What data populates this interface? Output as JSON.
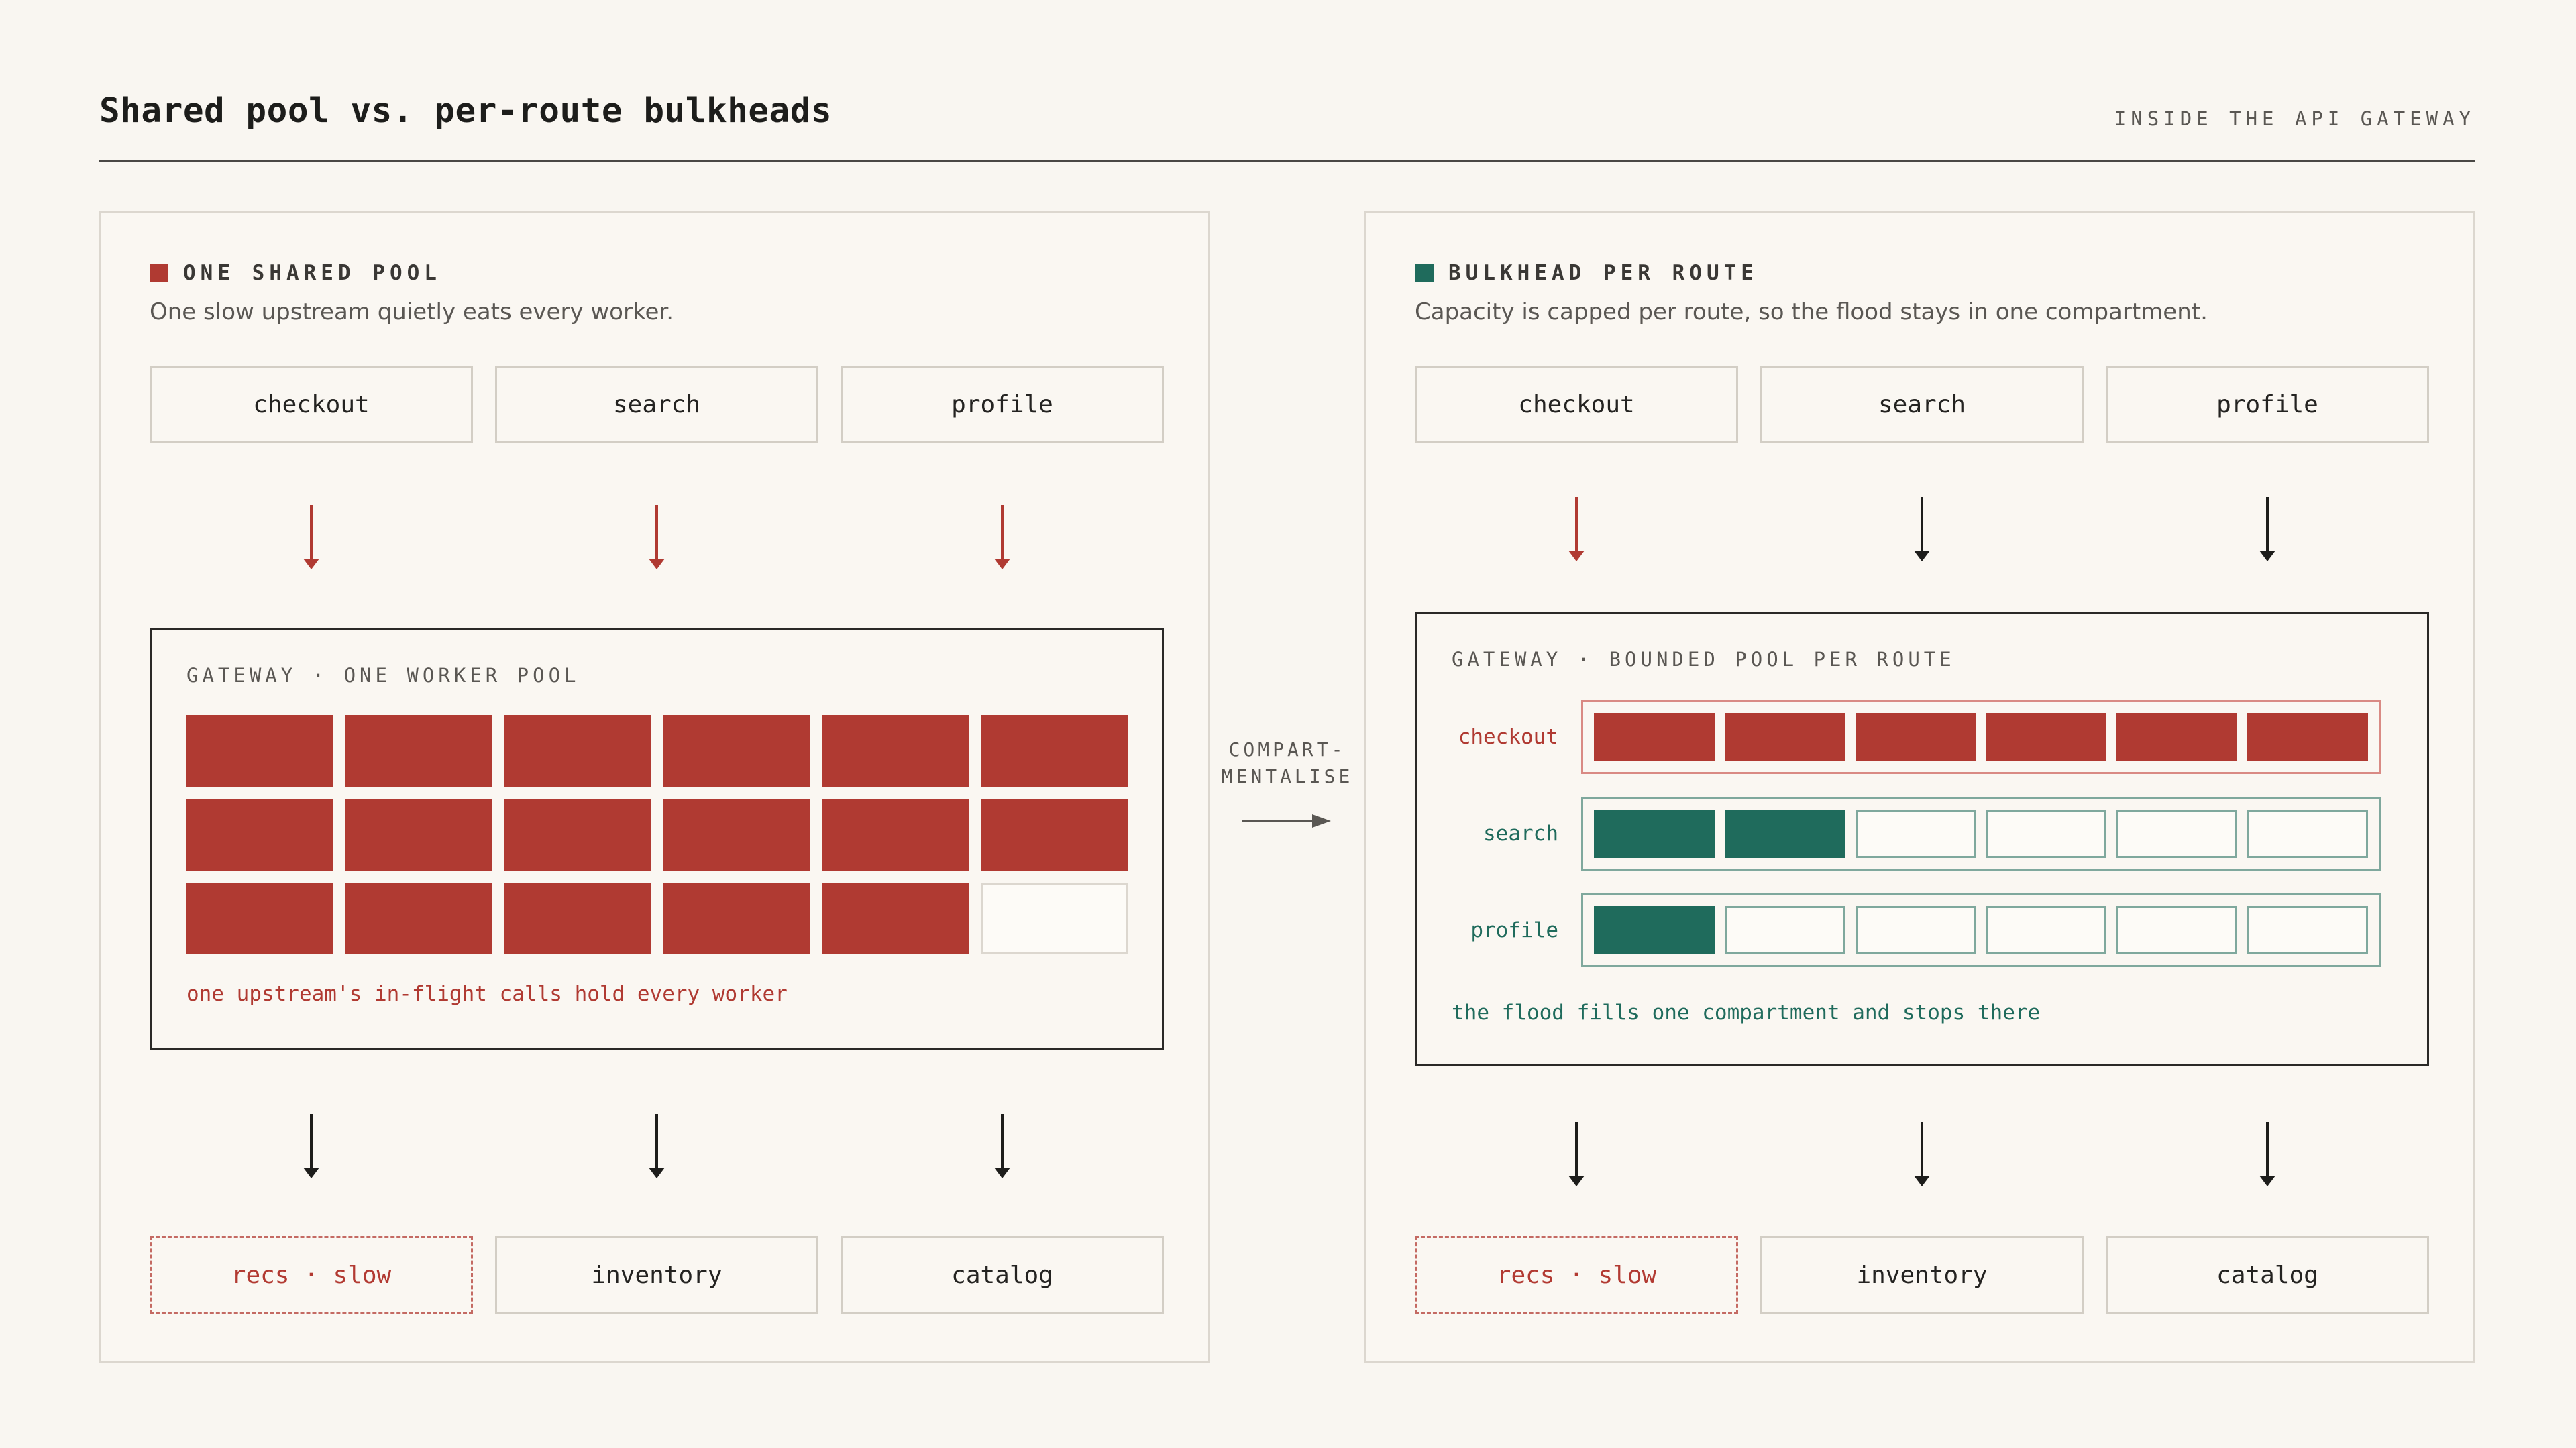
{
  "header": {
    "title": "Shared pool vs. per-route bulkheads",
    "eyebrow": "INSIDE THE API GATEWAY"
  },
  "colors": {
    "red": "#b03a32",
    "green": "#1f6b5c",
    "ink": "#1d1d1b",
    "background": "#f9f6f1"
  },
  "left": {
    "legend": "ONE SHARED POOL",
    "subtitle": "One slow upstream quietly eats every worker.",
    "routes": [
      "checkout",
      "search",
      "profile"
    ],
    "gateway_label": "GATEWAY · ONE WORKER POOL",
    "workers_total": 18,
    "workers_busy": 17,
    "note": "one upstream's in-flight calls hold every worker",
    "upstreams": [
      {
        "label": "recs · slow",
        "slow": true
      },
      {
        "label": "inventory",
        "slow": false
      },
      {
        "label": "catalog",
        "slow": false
      }
    ]
  },
  "middle": {
    "line1": "COMPART-",
    "line2": "MENTALISE"
  },
  "right": {
    "legend": "BULKHEAD PER ROUTE",
    "subtitle": "Capacity is capped per route, so the flood stays in one compartment.",
    "routes": [
      "checkout",
      "search",
      "profile"
    ],
    "gateway_label": "GATEWAY · BOUNDED POOL PER ROUTE",
    "compartments": [
      {
        "route": "checkout",
        "capacity": 6,
        "busy": 6,
        "tone": "red"
      },
      {
        "route": "search",
        "capacity": 6,
        "busy": 2,
        "tone": "green"
      },
      {
        "route": "profile",
        "capacity": 6,
        "busy": 1,
        "tone": "green"
      }
    ],
    "note": "the flood fills one compartment and stops there",
    "upstreams": [
      {
        "label": "recs · slow",
        "slow": true
      },
      {
        "label": "inventory",
        "slow": false
      },
      {
        "label": "catalog",
        "slow": false
      }
    ]
  }
}
